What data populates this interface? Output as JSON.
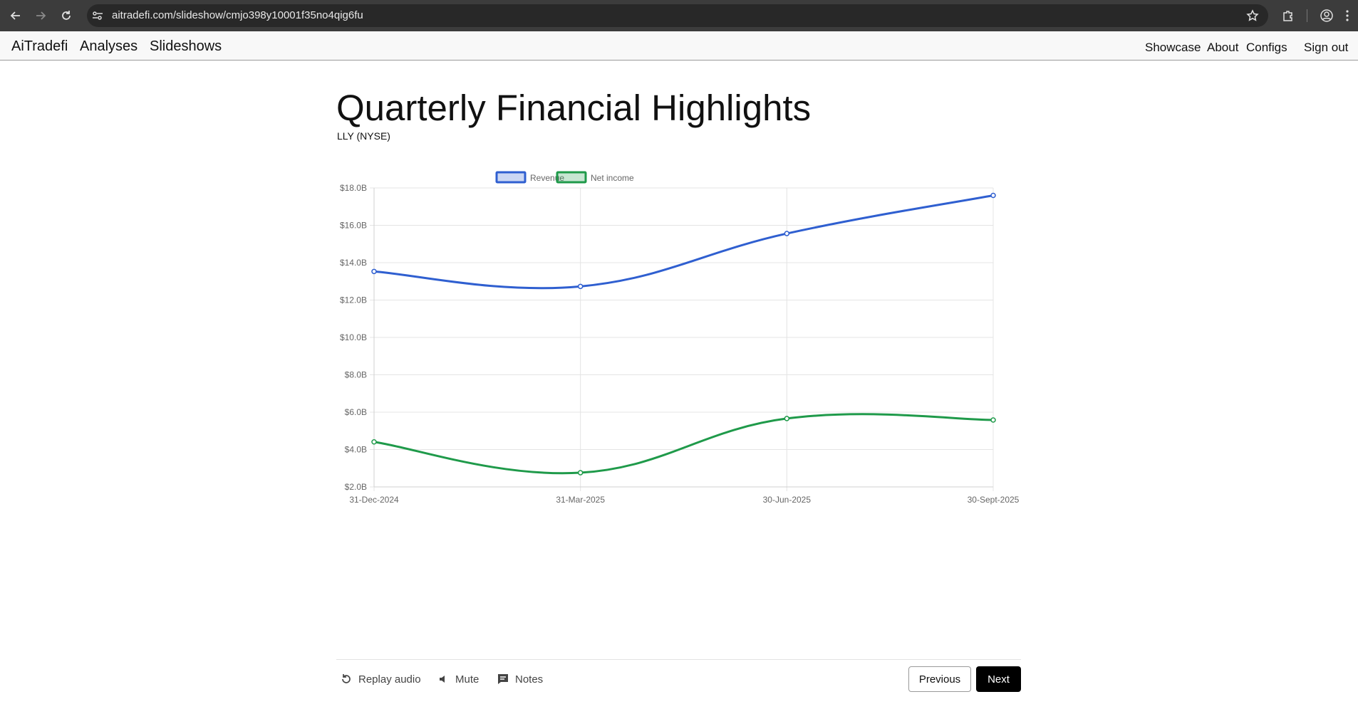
{
  "browser": {
    "url": "aitradefi.com/slideshow/cmjo398y10001f35no4qig6fu"
  },
  "nav": {
    "brand": "AiTradefi",
    "left_links": [
      "Analyses",
      "Slideshows"
    ],
    "right_links": [
      "Showcase",
      "About",
      "Configs",
      "Sign out"
    ]
  },
  "slide": {
    "title": "Quarterly Financial Highlights",
    "ticker": "LLY  (NYSE)"
  },
  "chart_data": {
    "type": "line",
    "x": [
      "31-Dec-2024",
      "31-Mar-2025",
      "30-Jun-2025",
      "30-Sept-2025"
    ],
    "series": [
      {
        "name": "Revenue",
        "values": [
          13.53,
          12.73,
          15.56,
          17.6
        ],
        "color": "#2f5fd0"
      },
      {
        "name": "Net income",
        "values": [
          4.41,
          2.76,
          5.66,
          5.58
        ],
        "color": "#1f9a4a"
      }
    ],
    "ylim": [
      2,
      18
    ],
    "yticks": [
      2,
      4,
      6,
      8,
      10,
      12,
      14,
      16,
      18
    ],
    "ytick_labels": [
      "$2.0B",
      "$4.0B",
      "$6.0B",
      "$8.0B",
      "$10.0B",
      "$12.0B",
      "$14.0B",
      "$16.0B",
      "$18.0B"
    ],
    "grid": true,
    "legend_position": "top-center",
    "title": "",
    "xlabel": "",
    "ylabel": ""
  },
  "controls": {
    "replay": "Replay audio",
    "mute": "Mute",
    "notes": "Notes",
    "previous": "Previous",
    "next": "Next"
  }
}
